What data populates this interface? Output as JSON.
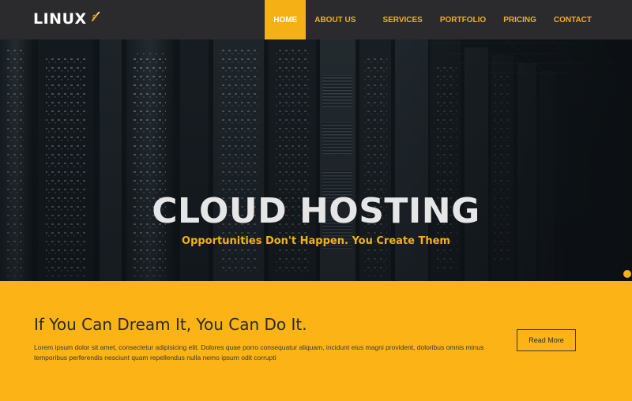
{
  "brand": {
    "logo_text": "LINUX",
    "logo_icon": "pencil-spark-icon",
    "accent": "#f5b016"
  },
  "nav": {
    "items": [
      {
        "label": "Home",
        "active": true
      },
      {
        "label": "About Us",
        "active": false
      },
      {
        "label": "Services",
        "active": false
      },
      {
        "label": "Portfolio",
        "active": false
      },
      {
        "label": "Pricing",
        "active": false
      },
      {
        "label": "Contact",
        "active": false
      }
    ]
  },
  "hero": {
    "title": "CLOUD HOSTING",
    "subtitle": "Opportunities Don't Happen. You Create Them"
  },
  "band": {
    "heading": "If You Can Dream It, You Can Do It.",
    "text": "Lorem ipsum dolor sit amet, consectetur adipisicing elit. Dolores quae porro consequatur aliquam, incidunt eius magni provident, doloribus omnis minus temporibus perferendis nesciunt quam repellendus nulla nemo ipsum odit corrupti",
    "button_label": "Read More"
  }
}
